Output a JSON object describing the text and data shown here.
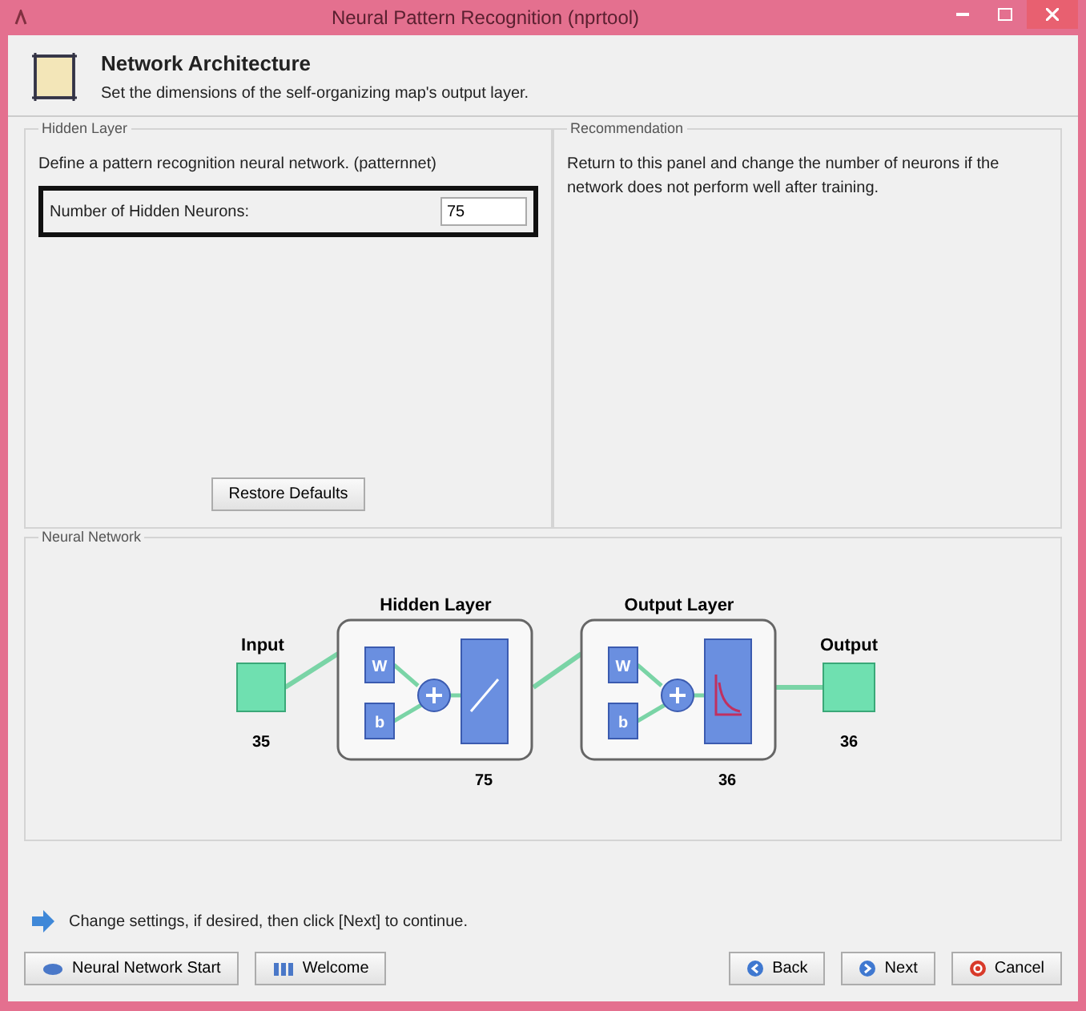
{
  "window": {
    "title": "Neural Pattern Recognition (nprtool)"
  },
  "header": {
    "title": "Network Architecture",
    "subtitle": "Set the dimensions of the self-organizing map's output layer."
  },
  "hidden_layer": {
    "title": "Hidden Layer",
    "description": "Define a pattern recognition neural network. (patternnet)",
    "field_label": "Number of Hidden Neurons:",
    "value": "75",
    "highlighted": true,
    "button": "Restore Defaults"
  },
  "recommendation": {
    "title": "Recommendation",
    "text": "Return to this panel and change the number of neurons if the network does not perform well after training."
  },
  "network": {
    "title": "Neural Network",
    "input": {
      "label": "Input",
      "size": "35"
    },
    "layers": [
      {
        "title": "Hidden Layer",
        "weight": "W",
        "bias": "b",
        "kind": "linear",
        "size": "75"
      },
      {
        "title": "Output Layer",
        "weight": "W",
        "bias": "b",
        "kind": "softmax",
        "size": "36"
      }
    ],
    "output": {
      "label": "Output",
      "size": "36"
    }
  },
  "hint": "Change settings, if desired, then click [Next] to continue.",
  "buttons": [
    {
      "label": "Neural Network Start",
      "kind": "start"
    },
    {
      "label": "Welcome",
      "kind": "welcome"
    },
    {
      "label": "Back",
      "kind": "back"
    },
    {
      "label": "Next",
      "kind": "next"
    },
    {
      "label": "Cancel",
      "kind": "cancel"
    }
  ]
}
